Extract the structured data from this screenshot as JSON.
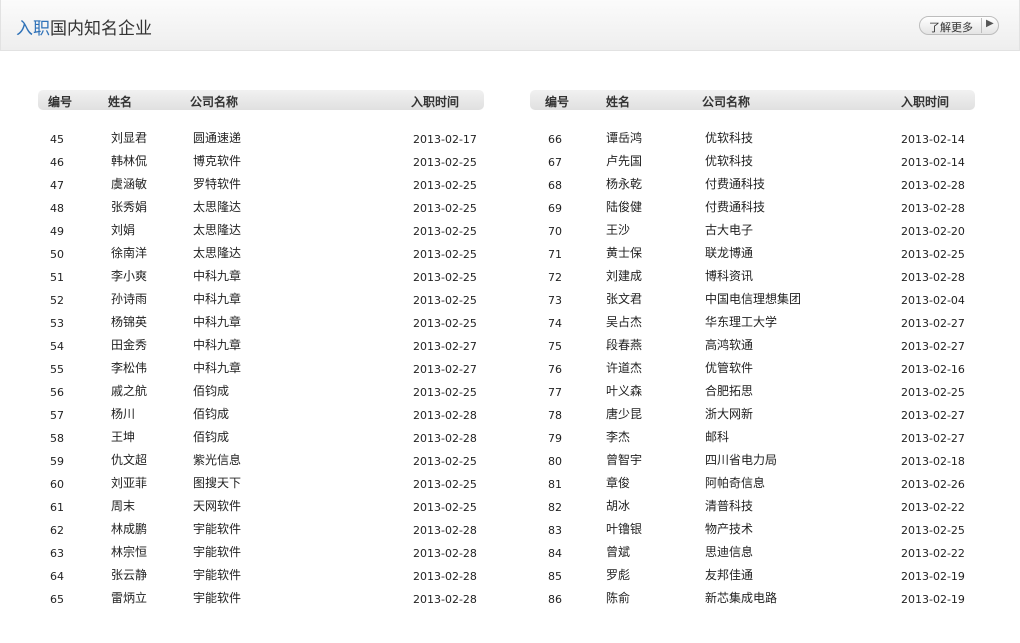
{
  "header": {
    "title_accent": "入职",
    "title_rest": "国内知名企业",
    "more_label": "了解更多",
    "more_arrow": "▶"
  },
  "columns": {
    "no": "编号",
    "name": "姓名",
    "company": "公司名称",
    "date": "入职时间"
  },
  "left_rows": [
    {
      "no": "45",
      "name": "刘显君",
      "company": "圆通速递",
      "date": "2013-02-17"
    },
    {
      "no": "46",
      "name": "韩林侃",
      "company": "博克软件",
      "date": "2013-02-25"
    },
    {
      "no": "47",
      "name": "虞涵敏",
      "company": "罗特软件",
      "date": "2013-02-25"
    },
    {
      "no": "48",
      "name": "张秀娟",
      "company": "太思隆达",
      "date": "2013-02-25"
    },
    {
      "no": "49",
      "name": "刘娟",
      "company": "太思隆达",
      "date": "2013-02-25"
    },
    {
      "no": "50",
      "name": "徐南洋",
      "company": "太思隆达",
      "date": "2013-02-25"
    },
    {
      "no": "51",
      "name": "李小爽",
      "company": "中科九章",
      "date": "2013-02-25"
    },
    {
      "no": "52",
      "name": "孙诗雨",
      "company": "中科九章",
      "date": "2013-02-25"
    },
    {
      "no": "53",
      "name": "杨锦英",
      "company": "中科九章",
      "date": "2013-02-25"
    },
    {
      "no": "54",
      "name": "田金秀",
      "company": "中科九章",
      "date": "2013-02-27"
    },
    {
      "no": "55",
      "name": "李松伟",
      "company": "中科九章",
      "date": "2013-02-27"
    },
    {
      "no": "56",
      "name": "戚之航",
      "company": "佰钧成",
      "date": "2013-02-25"
    },
    {
      "no": "57",
      "name": "杨川",
      "company": "佰钧成",
      "date": "2013-02-28"
    },
    {
      "no": "58",
      "name": "王坤",
      "company": "佰钧成",
      "date": "2013-02-28"
    },
    {
      "no": "59",
      "name": "仇文超",
      "company": "紫光信息",
      "date": "2013-02-25"
    },
    {
      "no": "60",
      "name": "刘亚菲",
      "company": "图搜天下",
      "date": "2013-02-25"
    },
    {
      "no": "61",
      "name": "周末",
      "company": "天网软件",
      "date": "2013-02-25"
    },
    {
      "no": "62",
      "name": "林成鹏",
      "company": "宇能软件",
      "date": "2013-02-28"
    },
    {
      "no": "63",
      "name": "林宗恒",
      "company": "宇能软件",
      "date": "2013-02-28"
    },
    {
      "no": "64",
      "name": "张云静",
      "company": "宇能软件",
      "date": "2013-02-28"
    },
    {
      "no": "65",
      "name": "雷炳立",
      "company": "宇能软件",
      "date": "2013-02-28"
    }
  ],
  "right_rows": [
    {
      "no": "66",
      "name": "谭岳鸿",
      "company": "优软科技",
      "date": "2013-02-14"
    },
    {
      "no": "67",
      "name": "卢先国",
      "company": "优软科技",
      "date": "2013-02-14"
    },
    {
      "no": "68",
      "name": "杨永乾",
      "company": "付费通科技",
      "date": "2013-02-28"
    },
    {
      "no": "69",
      "name": "陆俊健",
      "company": "付费通科技",
      "date": "2013-02-28"
    },
    {
      "no": "70",
      "name": "王沙",
      "company": "古大电子",
      "date": "2013-02-20"
    },
    {
      "no": "71",
      "name": "黄士保",
      "company": "联龙博通",
      "date": "2013-02-25"
    },
    {
      "no": "72",
      "name": "刘建成",
      "company": "博科资讯",
      "date": "2013-02-28"
    },
    {
      "no": "73",
      "name": "张文君",
      "company": "中国电信理想集团",
      "date": "2013-02-04"
    },
    {
      "no": "74",
      "name": "吴占杰",
      "company": "华东理工大学",
      "date": "2013-02-27"
    },
    {
      "no": "75",
      "name": "段春燕",
      "company": "高鸿软通",
      "date": "2013-02-27"
    },
    {
      "no": "76",
      "name": "许道杰",
      "company": "优管软件",
      "date": "2013-02-16"
    },
    {
      "no": "77",
      "name": "叶义森",
      "company": "合肥拓思",
      "date": "2013-02-25"
    },
    {
      "no": "78",
      "name": "唐少昆",
      "company": "浙大网新",
      "date": "2013-02-27"
    },
    {
      "no": "79",
      "name": "李杰",
      "company": "邮科",
      "date": "2013-02-27"
    },
    {
      "no": "80",
      "name": "曾智宇",
      "company": "四川省电力局",
      "date": "2013-02-18"
    },
    {
      "no": "81",
      "name": "章俊",
      "company": "阿帕奇信息",
      "date": "2013-02-26"
    },
    {
      "no": "82",
      "name": "胡冰",
      "company": "清普科技",
      "date": "2013-02-22"
    },
    {
      "no": "83",
      "name": "叶镥银",
      "company": "物产技术",
      "date": "2013-02-25"
    },
    {
      "no": "84",
      "name": "曾斌",
      "company": "思迪信息",
      "date": "2013-02-22"
    },
    {
      "no": "85",
      "name": "罗彪",
      "company": "友邦佳通",
      "date": "2013-02-19"
    },
    {
      "no": "86",
      "name": "陈俞",
      "company": "新芯集成电路",
      "date": "2013-02-19"
    }
  ]
}
